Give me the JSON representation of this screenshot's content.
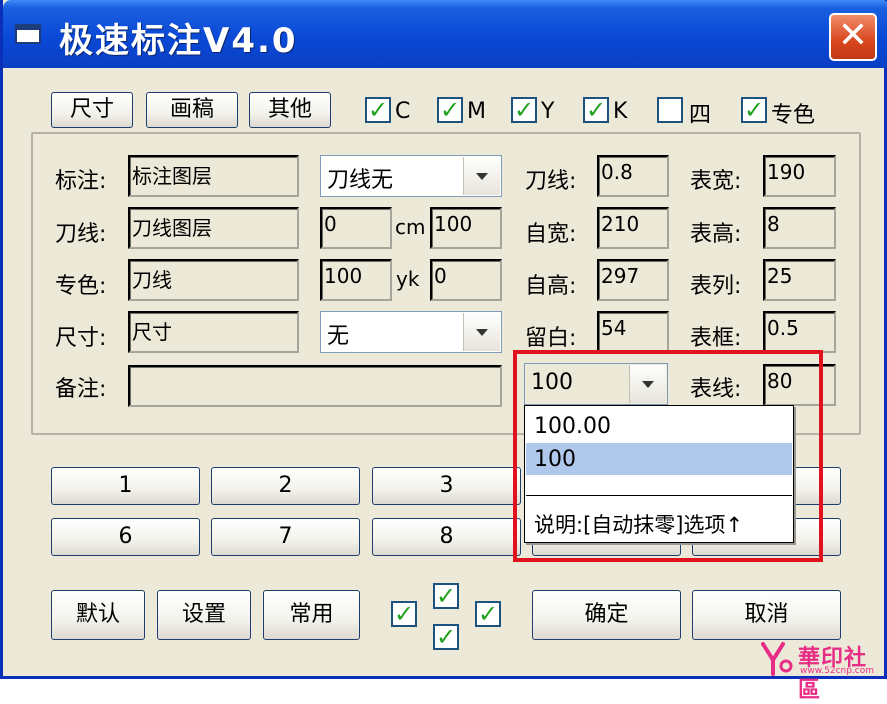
{
  "window": {
    "title": "极速标注V4.0",
    "close_glyph": "✕"
  },
  "tabs": [
    "尺寸",
    "画稿",
    "其他"
  ],
  "check_glyph": "✓",
  "checkboxes": [
    {
      "label": "C",
      "checked": true
    },
    {
      "label": "M",
      "checked": true
    },
    {
      "label": "Y",
      "checked": true
    },
    {
      "label": "K",
      "checked": true
    },
    {
      "label": "四",
      "checked": false
    },
    {
      "label": "专色",
      "checked": true
    }
  ],
  "form": {
    "annotation_label": "标注:",
    "annotation_layer": "标注图层",
    "cutline_mode": "刀线无",
    "knife_line_label": "刀线:",
    "knife_line_value": "0.8",
    "table_width_label": "表宽:",
    "table_width_value": "190",
    "cutline_label": "刀线:",
    "cutline_layer": "刀线图层",
    "cut_a": "0",
    "cut_unit": "cm",
    "cut_b": "100",
    "self_width_label": "自宽:",
    "self_width_value": "210",
    "table_height_label": "表高:",
    "table_height_value": "8",
    "spot_label": "专色:",
    "spot_value": "刀线",
    "spot_a": "100",
    "spot_unit": "yk",
    "spot_b": "0",
    "self_height_label": "自高:",
    "self_height_value": "297",
    "table_cols_label": "表列:",
    "table_cols_value": "25",
    "size_label": "尺寸:",
    "size_value": "尺寸",
    "size_mode": "无",
    "margin_label": "留白:",
    "margin_value": "54",
    "table_frame_label": "表框:",
    "table_frame_value": "0.5",
    "note_label": "备注:",
    "note_value": "",
    "rounding_value": "100",
    "table_line_label": "表线:",
    "table_line_value": "80"
  },
  "dropdown": {
    "options": [
      "100.00",
      "100"
    ],
    "selected_index": 1,
    "note": "说明:[自动抹零]选项↑"
  },
  "number_buttons_row1": [
    "1",
    "2",
    "3"
  ],
  "number_buttons_row2": [
    "6",
    "7",
    "8"
  ],
  "bottom": {
    "default_label": "默认",
    "settings_label": "设置",
    "common_label": "常用",
    "ok_label": "确定",
    "cancel_label": "取消"
  },
  "watermark": {
    "text": "華印社區",
    "url": "www.52cnp.com"
  },
  "colors": {
    "title_bar": "#0a49d6",
    "close": "#d8461c",
    "highlight_box": "#e0121e",
    "selected_row": "#b0c8ec",
    "check": "#21a121",
    "window_bg": "#ece9d8"
  }
}
